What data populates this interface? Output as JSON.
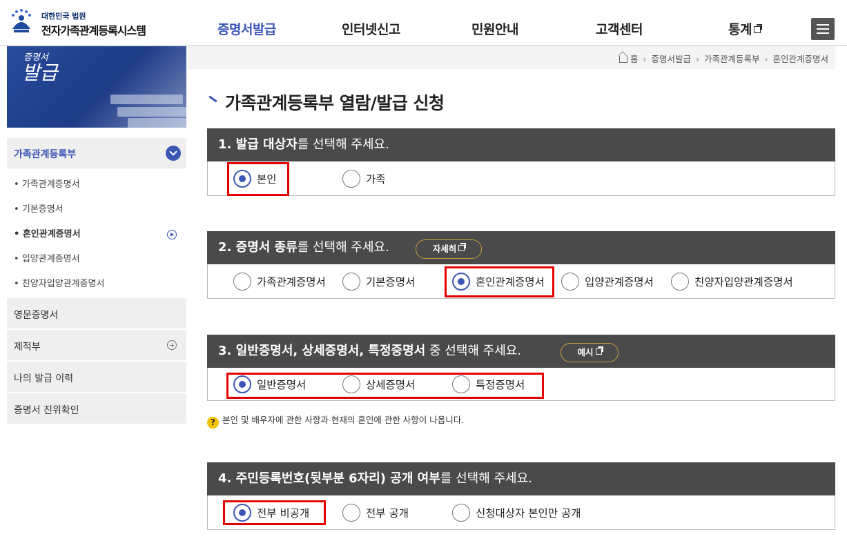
{
  "header": {
    "logo_top": "대한민국 법원",
    "logo_main": "전자가족관계등록시스템",
    "nav": [
      {
        "label": "증명서발급",
        "active": true
      },
      {
        "label": "인터넷신고",
        "active": false
      },
      {
        "label": "민원안내",
        "active": false
      },
      {
        "label": "고객센터",
        "active": false
      },
      {
        "label": "통계",
        "active": false
      }
    ]
  },
  "sidebar": {
    "banner_small": "증명서",
    "banner_big": "발급",
    "group_title": "가족관계등록부",
    "sub_items": [
      "가족관계증명서",
      "기본증명서",
      "혼인관계증명서",
      "입양관계증명서",
      "친양자입양관계증명서"
    ],
    "sub_active_index": 2,
    "other_items": [
      "영문증명서",
      "제적부",
      "나의 발급 이력",
      "증명서 진위확인"
    ]
  },
  "breadcrumb": [
    "홈",
    "증명서발급",
    "가족관계등록부",
    "혼인관계증명서"
  ],
  "page_title": "가족관계등록부 열람/발급 신청",
  "sections": [
    {
      "bold": "1. 발급 대상자",
      "rest": "를 선택해 주세요.",
      "options": [
        "본인",
        "가족"
      ],
      "selected": 0
    },
    {
      "bold": "2. 증명서 종류",
      "rest": "를 선택해 주세요.",
      "button": "자세히",
      "options": [
        "가족관계증명서",
        "기본증명서",
        "혼인관계증명서",
        "입양관계증명서",
        "친양자입양관계증명서"
      ],
      "selected": 2
    },
    {
      "bold": "3. 일반증명서, 상세증명서, 특정증명서",
      "rest": " 중 선택해 주세요.",
      "button": "예시",
      "options": [
        "일반증명서",
        "상세증명서",
        "특정증명서"
      ],
      "selected": 0
    },
    {
      "bold": "4. 주민등록번호(뒷부분 6자리) 공개 여부",
      "rest": "를 선택해 주세요.",
      "options": [
        "전부 비공개",
        "전부 공개",
        "신청대상자 본인만 공개"
      ],
      "selected": 0
    }
  ],
  "note": "본인 및 배우자에 관한 사항과 현재의 혼인에 관한 사항이 나옵니다.",
  "colors": {
    "accent": "#3b56b5",
    "header_bar": "#4a4a4a",
    "highlight": "#e50000",
    "pill_border": "#c9a23a"
  }
}
